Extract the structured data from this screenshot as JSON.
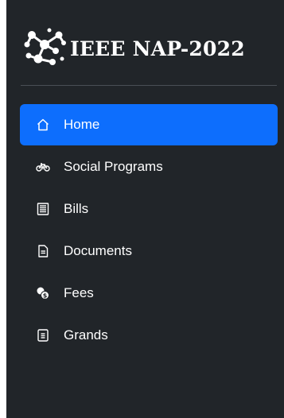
{
  "brand": {
    "title": "IEEE NAP-2022",
    "logo_icon": "molecule-logo-icon"
  },
  "nav": {
    "items": [
      {
        "label": "Home",
        "icon": "house-icon",
        "active": true
      },
      {
        "label": "Social Programs",
        "icon": "bicycle-icon",
        "active": false
      },
      {
        "label": "Bills",
        "icon": "receipt-icon",
        "active": false
      },
      {
        "label": "Documents",
        "icon": "document-icon",
        "active": false
      },
      {
        "label": "Fees",
        "icon": "coins-icon",
        "active": false
      },
      {
        "label": "Grands",
        "icon": "clipboard-icon",
        "active": false
      }
    ]
  },
  "colors": {
    "sidebar_bg": "#212529",
    "active_bg": "#0d6efd",
    "text": "#ffffff"
  }
}
